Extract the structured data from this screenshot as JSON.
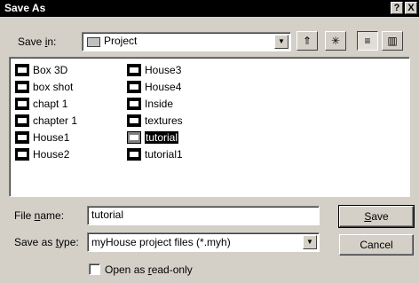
{
  "window": {
    "title": "Save As",
    "help_glyph": "?",
    "close_glyph": "X"
  },
  "save_in": {
    "label_pre": "Save ",
    "label_key": "i",
    "label_post": "n:",
    "value": "Project"
  },
  "toolbar": {
    "up_glyph": "⇑",
    "new_folder_glyph": "✳",
    "list_glyph": "≡",
    "details_glyph": "▥"
  },
  "files": {
    "column1": [
      "Box 3D",
      "box shot",
      "chapt 1",
      "chapter 1",
      "House1",
      "House2"
    ],
    "column2": [
      "House3",
      "House4",
      "Inside",
      "textures",
      "tutorial",
      "tutorial1"
    ],
    "selected": "tutorial"
  },
  "file_name": {
    "label_pre": "File ",
    "label_key": "n",
    "label_post": "ame:",
    "value": "tutorial"
  },
  "save_as_type": {
    "label_pre": "Save as ",
    "label_key": "t",
    "label_post": "ype:",
    "value": "myHouse project files (*.myh)"
  },
  "buttons": {
    "save_key": "S",
    "save_rest": "ave",
    "cancel": "Cancel"
  },
  "read_only": {
    "label_pre": "Open as ",
    "label_key": "r",
    "label_post": "ead-only",
    "checked": false
  },
  "colors": {
    "dialog_bg": "#d4d0c8",
    "titlebar_bg": "#000000",
    "selection_bg": "#000000"
  }
}
